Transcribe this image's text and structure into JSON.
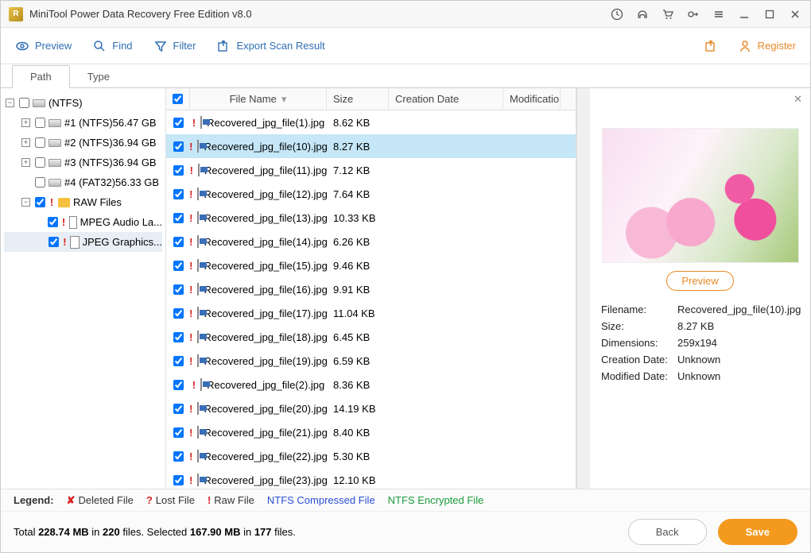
{
  "title": "MiniTool Power Data Recovery Free Edition v8.0",
  "toolbar": {
    "preview": "Preview",
    "find": "Find",
    "filter": "Filter",
    "export": "Export Scan Result",
    "register": "Register"
  },
  "tabs": {
    "path": "Path",
    "type": "Type"
  },
  "tree": {
    "root": " (NTFS)",
    "p1": "#1 (NTFS)56.47 GB",
    "p2": "#2 (NTFS)36.94 GB",
    "p3": "#3 (NTFS)36.94 GB",
    "p4": "#4 (FAT32)56.33 GB",
    "raw": "RAW Files",
    "mpeg": "MPEG Audio La...",
    "jpeg": "JPEG Graphics..."
  },
  "columns": {
    "name": "File Name",
    "size": "Size",
    "cd": "Creation Date",
    "md": "Modification"
  },
  "files": [
    {
      "name": "Recovered_jpg_file(1).jpg",
      "size": "8.62 KB"
    },
    {
      "name": "Recovered_jpg_file(10).jpg",
      "size": "8.27 KB",
      "selected": true
    },
    {
      "name": "Recovered_jpg_file(11).jpg",
      "size": "7.12 KB"
    },
    {
      "name": "Recovered_jpg_file(12).jpg",
      "size": "7.64 KB"
    },
    {
      "name": "Recovered_jpg_file(13).jpg",
      "size": "10.33 KB"
    },
    {
      "name": "Recovered_jpg_file(14).jpg",
      "size": "6.26 KB"
    },
    {
      "name": "Recovered_jpg_file(15).jpg",
      "size": "9.46 KB"
    },
    {
      "name": "Recovered_jpg_file(16).jpg",
      "size": "9.91 KB"
    },
    {
      "name": "Recovered_jpg_file(17).jpg",
      "size": "11.04 KB"
    },
    {
      "name": "Recovered_jpg_file(18).jpg",
      "size": "6.45 KB"
    },
    {
      "name": "Recovered_jpg_file(19).jpg",
      "size": "6.59 KB"
    },
    {
      "name": "Recovered_jpg_file(2).jpg",
      "size": "8.36 KB"
    },
    {
      "name": "Recovered_jpg_file(20).jpg",
      "size": "14.19 KB"
    },
    {
      "name": "Recovered_jpg_file(21).jpg",
      "size": "8.40 KB"
    },
    {
      "name": "Recovered_jpg_file(22).jpg",
      "size": "5.30 KB"
    },
    {
      "name": "Recovered_jpg_file(23).jpg",
      "size": "12.10 KB"
    }
  ],
  "preview": {
    "button": "Preview",
    "labels": {
      "filename": "Filename:",
      "size": "Size:",
      "dim": "Dimensions:",
      "cd": "Creation Date:",
      "md": "Modified Date:"
    },
    "filename": "Recovered_jpg_file(10).jpg",
    "size": "8.27 KB",
    "dim": "259x194",
    "cd": "Unknown",
    "md": "Unknown"
  },
  "legend": {
    "title": "Legend:",
    "deleted": "Deleted File",
    "lost": "Lost File",
    "raw": "Raw File",
    "ntfsc": "NTFS Compressed File",
    "ntfse": "NTFS Encrypted File"
  },
  "status": {
    "t1": "Total ",
    "v1": "228.74 MB",
    "t2": " in ",
    "v2": "220",
    "t3": " files.   Selected ",
    "v3": "167.90 MB",
    "t4": " in ",
    "v4": "177",
    "t5": " files.",
    "back": "Back",
    "save": "Save"
  }
}
